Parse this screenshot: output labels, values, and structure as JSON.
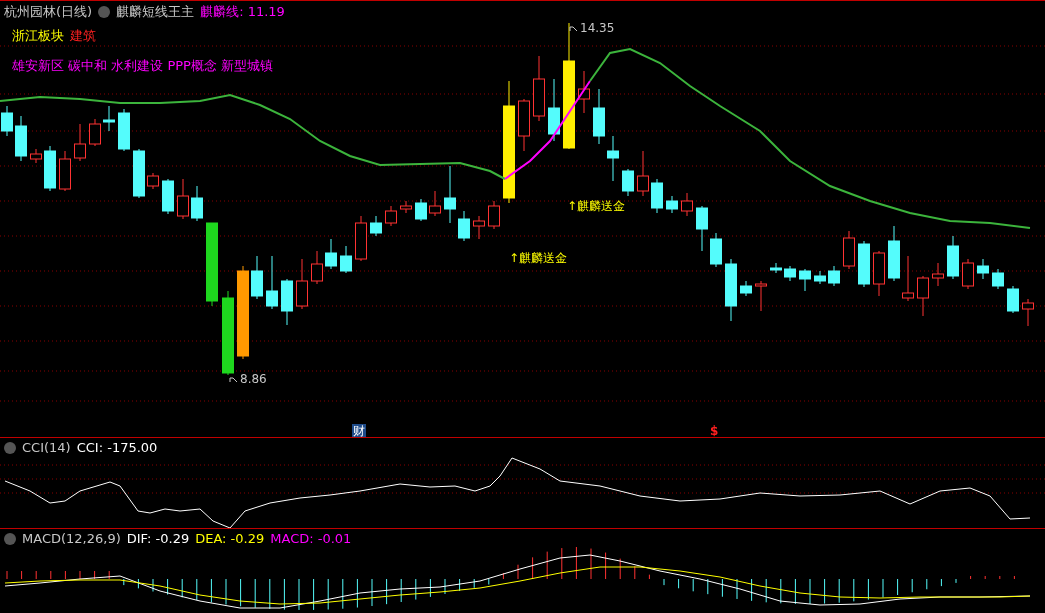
{
  "header": {
    "stock": "杭州园林(日线)",
    "indicator": "麒麟短线王主",
    "value_label": "麒麟线: 11.19"
  },
  "sectors": {
    "primary": "浙江板块",
    "tag": "建筑"
  },
  "concepts": "雄安新区 碳中和 水利建设 PPP概念 新型城镇",
  "annotations": [
    {
      "kind": "high",
      "text": "14.35"
    },
    {
      "kind": "low",
      "text": "8.86"
    },
    {
      "kind": "signal",
      "text": "↑麒麟送金"
    },
    {
      "kind": "signal",
      "text": "↑麒麟送金"
    }
  ],
  "markers": [
    {
      "kind": "finance",
      "text": "财"
    },
    {
      "kind": "dollar",
      "text": "$"
    }
  ],
  "cci": {
    "title": "CCI(14)",
    "reading": "CCI: -175.00"
  },
  "macd": {
    "title": "MACD(12,26,9)",
    "dif": "DIF: -0.29",
    "dea": "DEA: -0.29",
    "macd": "MACD: -0.01"
  }
}
